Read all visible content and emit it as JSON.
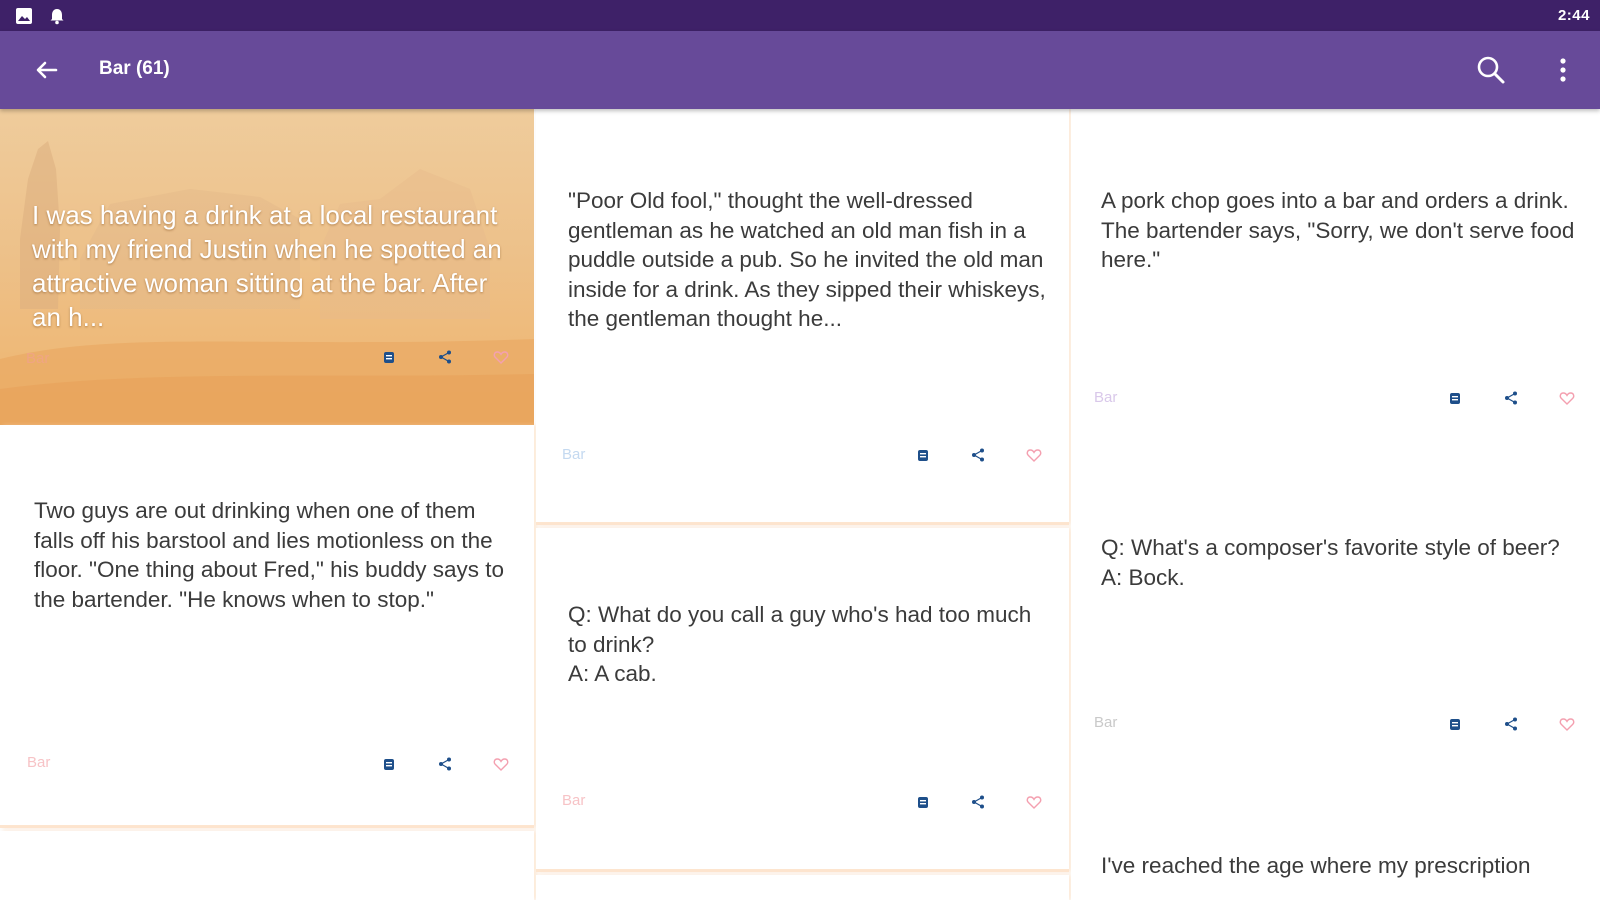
{
  "status_bar": {
    "time": "2:44",
    "left_icons": [
      "image-icon",
      "bell-icon"
    ]
  },
  "toolbar": {
    "title": "Bar (61)",
    "icons": [
      "back-arrow-icon",
      "search-icon",
      "more-vert-icon"
    ]
  },
  "colors": {
    "status_bar": "#3e2168",
    "toolbar": "#674a99",
    "accent_blue": "#1e4f8a",
    "heart_pink": "#f4a0b0",
    "category_pink": "#f7c3c6",
    "category_blue": "#c4d9f0",
    "category_purple": "#d9c8ea",
    "category_gray": "#c9c9c9"
  },
  "cards": [
    {
      "id": "c1",
      "text": "I was having a drink at a local restaurant with my friend Justin when he spotted an attractive woman sitting at the bar. After an h...",
      "category": "Bar"
    },
    {
      "id": "c2",
      "text": "\"Poor Old fool,\" thought the well-dressed gentleman as he watched an old man fish in a puddle outside a pub. So he invited the old man inside for a drink. As they sipped their whiskeys, the gentleman thought he...",
      "category": "Bar"
    },
    {
      "id": "c3",
      "text": "A pork chop goes into a bar and orders a drink. The bartender says, \"Sorry, we don't serve food here.\"",
      "category": "Bar"
    },
    {
      "id": "c4",
      "text": "Two guys are out drinking when one of them falls off his barstool and lies motionless on the floor. \"One thing about Fred,\" his buddy says to the bartender. \"He knows when to stop.\"",
      "category": "Bar"
    },
    {
      "id": "c5",
      "text": "Q: What do you call a guy who's had too much to drink?\nA: A cab.",
      "category": "Bar"
    },
    {
      "id": "c6",
      "text": "Q: What's a composer's favorite style of beer? A: Bock.",
      "category": "Bar"
    },
    {
      "id": "c7",
      "text": "I've reached the age where my prescription"
    }
  ],
  "card_actions": [
    "copy-icon",
    "share-icon",
    "heart-icon"
  ]
}
